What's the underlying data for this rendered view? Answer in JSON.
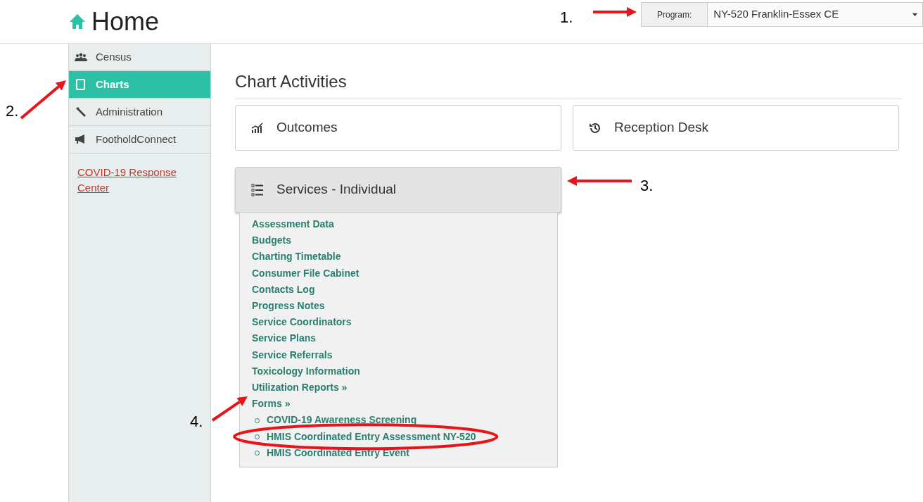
{
  "page": {
    "title": "Home"
  },
  "program": {
    "label": "Program:",
    "value": "NY-520 Franklin-Essex CE"
  },
  "sidebar": {
    "items": [
      {
        "label": "Census",
        "selected": false
      },
      {
        "label": "Charts",
        "selected": true
      },
      {
        "label": "Administration",
        "selected": false
      },
      {
        "label": "FootholdConnect",
        "selected": false
      }
    ],
    "link": "COVID-19 Response Center"
  },
  "main": {
    "heading": "Chart Activities",
    "tiles": [
      {
        "label": "Outcomes"
      },
      {
        "label": "Reception Desk"
      }
    ],
    "panel": {
      "title": "Services - Individual",
      "expanded": true,
      "links": [
        {
          "label": "Assessment Data"
        },
        {
          "label": "Budgets"
        },
        {
          "label": "Charting Timetable"
        },
        {
          "label": "Consumer File Cabinet"
        },
        {
          "label": "Contacts Log"
        },
        {
          "label": "Progress Notes"
        },
        {
          "label": "Service Coordinators"
        },
        {
          "label": "Service Plans"
        },
        {
          "label": "Service Referrals"
        },
        {
          "label": "Toxicology Information"
        },
        {
          "label": "Utilization Reports »"
        },
        {
          "label": "Forms »"
        }
      ],
      "forms": [
        {
          "label": "COVID-19 Awareness Screening",
          "circled": false
        },
        {
          "label": "HMIS Coordinated Entry Assessment NY-520",
          "circled": true
        },
        {
          "label": "HMIS Coordinated Entry Event",
          "circled": false
        }
      ]
    }
  },
  "annotations": [
    {
      "label": "1."
    },
    {
      "label": "2."
    },
    {
      "label": "3."
    },
    {
      "label": "4."
    }
  ]
}
